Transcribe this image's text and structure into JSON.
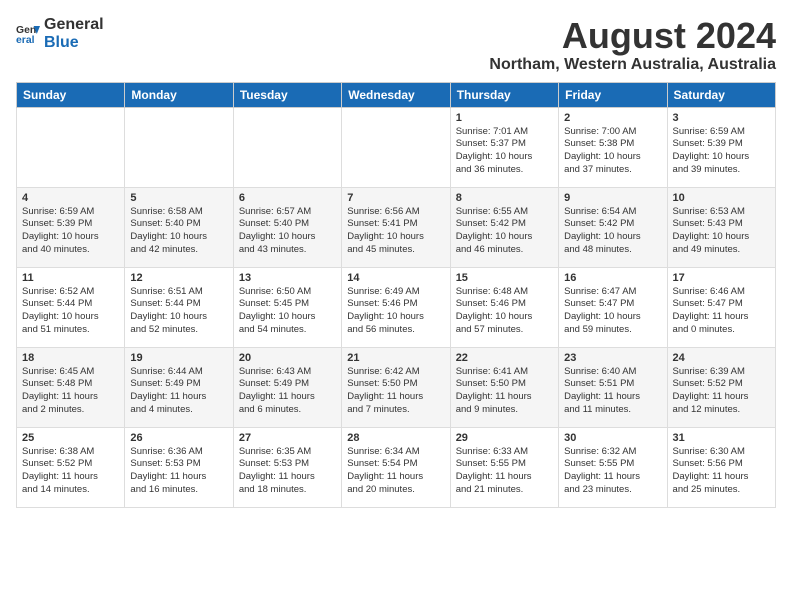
{
  "logo": {
    "general": "General",
    "blue": "Blue"
  },
  "title": "August 2024",
  "subtitle": "Northam, Western Australia, Australia",
  "days_of_week": [
    "Sunday",
    "Monday",
    "Tuesday",
    "Wednesday",
    "Thursday",
    "Friday",
    "Saturday"
  ],
  "weeks": [
    [
      {
        "day": "",
        "info": ""
      },
      {
        "day": "",
        "info": ""
      },
      {
        "day": "",
        "info": ""
      },
      {
        "day": "",
        "info": ""
      },
      {
        "day": "1",
        "info": "Sunrise: 7:01 AM\nSunset: 5:37 PM\nDaylight: 10 hours\nand 36 minutes."
      },
      {
        "day": "2",
        "info": "Sunrise: 7:00 AM\nSunset: 5:38 PM\nDaylight: 10 hours\nand 37 minutes."
      },
      {
        "day": "3",
        "info": "Sunrise: 6:59 AM\nSunset: 5:39 PM\nDaylight: 10 hours\nand 39 minutes."
      }
    ],
    [
      {
        "day": "4",
        "info": "Sunrise: 6:59 AM\nSunset: 5:39 PM\nDaylight: 10 hours\nand 40 minutes."
      },
      {
        "day": "5",
        "info": "Sunrise: 6:58 AM\nSunset: 5:40 PM\nDaylight: 10 hours\nand 42 minutes."
      },
      {
        "day": "6",
        "info": "Sunrise: 6:57 AM\nSunset: 5:40 PM\nDaylight: 10 hours\nand 43 minutes."
      },
      {
        "day": "7",
        "info": "Sunrise: 6:56 AM\nSunset: 5:41 PM\nDaylight: 10 hours\nand 45 minutes."
      },
      {
        "day": "8",
        "info": "Sunrise: 6:55 AM\nSunset: 5:42 PM\nDaylight: 10 hours\nand 46 minutes."
      },
      {
        "day": "9",
        "info": "Sunrise: 6:54 AM\nSunset: 5:42 PM\nDaylight: 10 hours\nand 48 minutes."
      },
      {
        "day": "10",
        "info": "Sunrise: 6:53 AM\nSunset: 5:43 PM\nDaylight: 10 hours\nand 49 minutes."
      }
    ],
    [
      {
        "day": "11",
        "info": "Sunrise: 6:52 AM\nSunset: 5:44 PM\nDaylight: 10 hours\nand 51 minutes."
      },
      {
        "day": "12",
        "info": "Sunrise: 6:51 AM\nSunset: 5:44 PM\nDaylight: 10 hours\nand 52 minutes."
      },
      {
        "day": "13",
        "info": "Sunrise: 6:50 AM\nSunset: 5:45 PM\nDaylight: 10 hours\nand 54 minutes."
      },
      {
        "day": "14",
        "info": "Sunrise: 6:49 AM\nSunset: 5:46 PM\nDaylight: 10 hours\nand 56 minutes."
      },
      {
        "day": "15",
        "info": "Sunrise: 6:48 AM\nSunset: 5:46 PM\nDaylight: 10 hours\nand 57 minutes."
      },
      {
        "day": "16",
        "info": "Sunrise: 6:47 AM\nSunset: 5:47 PM\nDaylight: 10 hours\nand 59 minutes."
      },
      {
        "day": "17",
        "info": "Sunrise: 6:46 AM\nSunset: 5:47 PM\nDaylight: 11 hours\nand 0 minutes."
      }
    ],
    [
      {
        "day": "18",
        "info": "Sunrise: 6:45 AM\nSunset: 5:48 PM\nDaylight: 11 hours\nand 2 minutes."
      },
      {
        "day": "19",
        "info": "Sunrise: 6:44 AM\nSunset: 5:49 PM\nDaylight: 11 hours\nand 4 minutes."
      },
      {
        "day": "20",
        "info": "Sunrise: 6:43 AM\nSunset: 5:49 PM\nDaylight: 11 hours\nand 6 minutes."
      },
      {
        "day": "21",
        "info": "Sunrise: 6:42 AM\nSunset: 5:50 PM\nDaylight: 11 hours\nand 7 minutes."
      },
      {
        "day": "22",
        "info": "Sunrise: 6:41 AM\nSunset: 5:50 PM\nDaylight: 11 hours\nand 9 minutes."
      },
      {
        "day": "23",
        "info": "Sunrise: 6:40 AM\nSunset: 5:51 PM\nDaylight: 11 hours\nand 11 minutes."
      },
      {
        "day": "24",
        "info": "Sunrise: 6:39 AM\nSunset: 5:52 PM\nDaylight: 11 hours\nand 12 minutes."
      }
    ],
    [
      {
        "day": "25",
        "info": "Sunrise: 6:38 AM\nSunset: 5:52 PM\nDaylight: 11 hours\nand 14 minutes."
      },
      {
        "day": "26",
        "info": "Sunrise: 6:36 AM\nSunset: 5:53 PM\nDaylight: 11 hours\nand 16 minutes."
      },
      {
        "day": "27",
        "info": "Sunrise: 6:35 AM\nSunset: 5:53 PM\nDaylight: 11 hours\nand 18 minutes."
      },
      {
        "day": "28",
        "info": "Sunrise: 6:34 AM\nSunset: 5:54 PM\nDaylight: 11 hours\nand 20 minutes."
      },
      {
        "day": "29",
        "info": "Sunrise: 6:33 AM\nSunset: 5:55 PM\nDaylight: 11 hours\nand 21 minutes."
      },
      {
        "day": "30",
        "info": "Sunrise: 6:32 AM\nSunset: 5:55 PM\nDaylight: 11 hours\nand 23 minutes."
      },
      {
        "day": "31",
        "info": "Sunrise: 6:30 AM\nSunset: 5:56 PM\nDaylight: 11 hours\nand 25 minutes."
      }
    ]
  ]
}
